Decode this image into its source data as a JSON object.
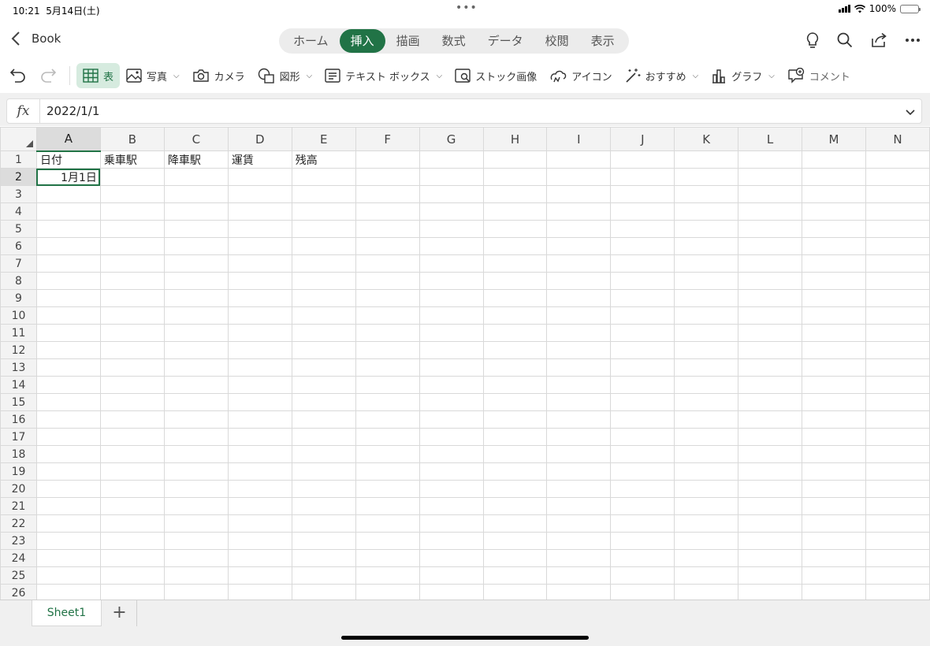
{
  "status": {
    "time": "10:21",
    "date": "5月14日(土)",
    "battery": "100%"
  },
  "app": {
    "back_label": "Book"
  },
  "tabs": [
    {
      "label": "ホーム",
      "active": false
    },
    {
      "label": "挿入",
      "active": true
    },
    {
      "label": "描画",
      "active": false
    },
    {
      "label": "数式",
      "active": false
    },
    {
      "label": "データ",
      "active": false
    },
    {
      "label": "校閲",
      "active": false
    },
    {
      "label": "表示",
      "active": false
    }
  ],
  "ribbon": {
    "table": "表",
    "photo": "写真",
    "camera": "カメラ",
    "shapes": "図形",
    "textbox": "テキスト ボックス",
    "stock": "ストック画像",
    "icons": "アイコン",
    "recommended": "おすすめ",
    "chart": "グラフ",
    "comment": "コメント"
  },
  "formula": {
    "fx": "fx",
    "value": "2022/1/1"
  },
  "sheet": {
    "columns": [
      "A",
      "B",
      "C",
      "D",
      "E",
      "F",
      "G",
      "H",
      "I",
      "J",
      "K",
      "L",
      "M",
      "N"
    ],
    "rows": [
      "1",
      "2",
      "3",
      "4",
      "5",
      "6",
      "7",
      "8",
      "9",
      "10",
      "11",
      "12",
      "13",
      "14",
      "15",
      "16",
      "17",
      "18",
      "19",
      "20",
      "21",
      "22",
      "23",
      "24",
      "25",
      "26"
    ],
    "selected_cell": "A2",
    "cells": {
      "A1": "日付",
      "B1": "乗車駅",
      "C1": "降車駅",
      "D1": "運賃",
      "E1": "残高",
      "A2": "1月1日"
    }
  },
  "sheet_tabs": {
    "active": "Sheet1",
    "add": "+"
  },
  "colors": {
    "accent": "#217346",
    "ribbon_selected": "#d6ebdf"
  }
}
